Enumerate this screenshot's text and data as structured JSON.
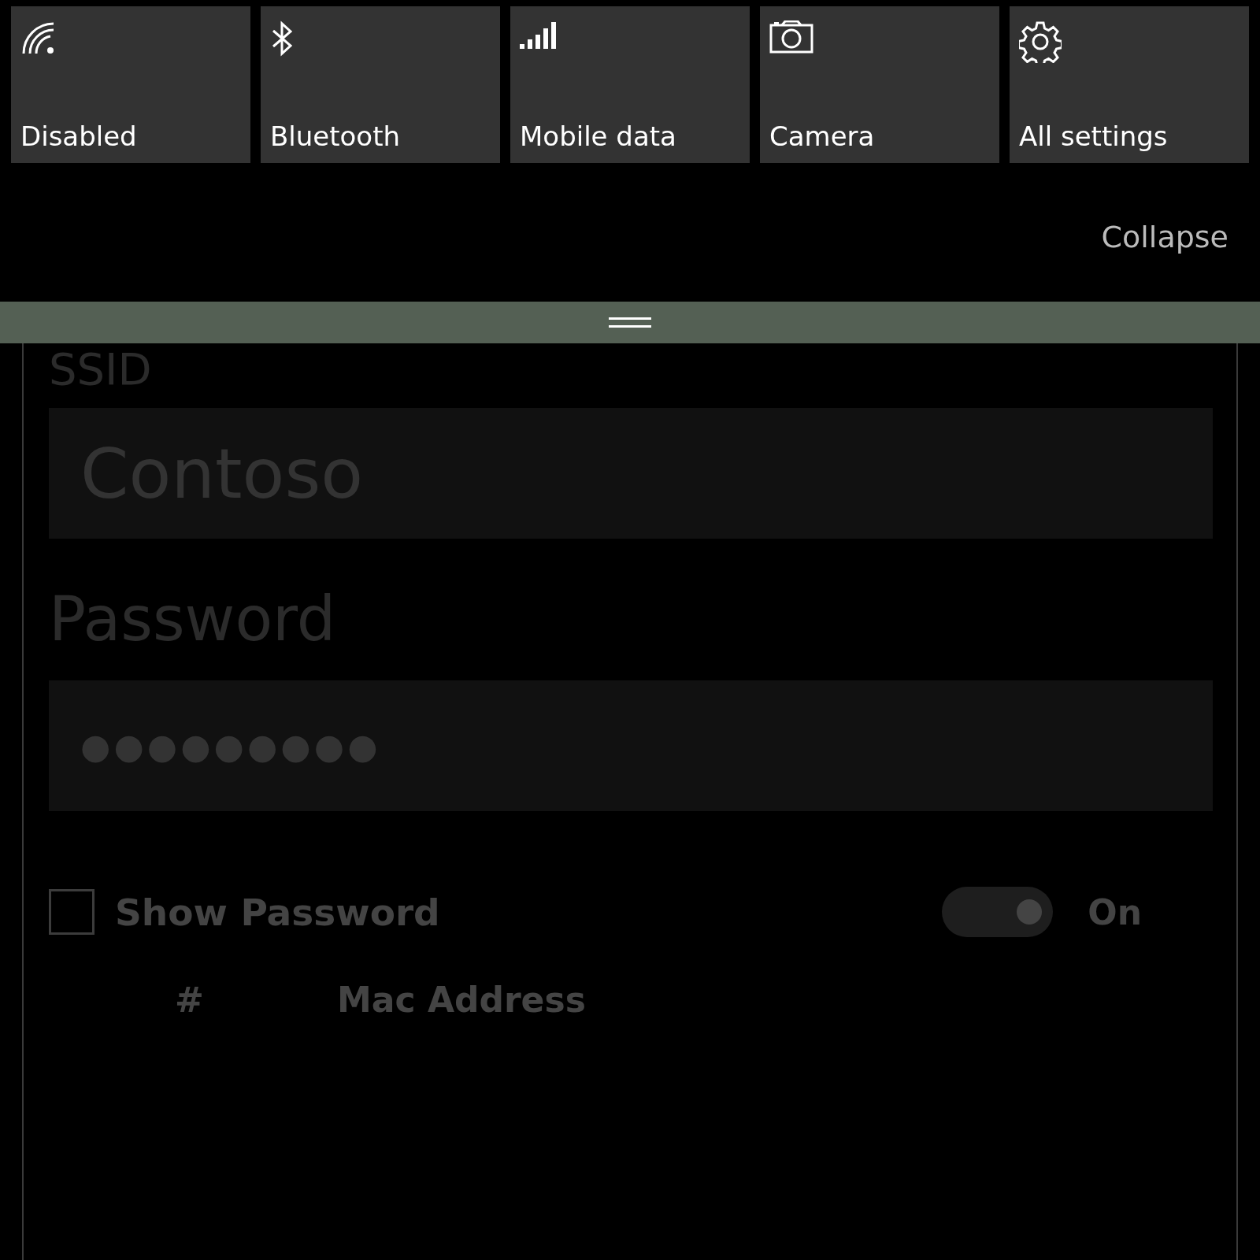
{
  "quick_actions": [
    {
      "kind": "wifi",
      "label": "Disabled"
    },
    {
      "kind": "bluetooth",
      "label": "Bluetooth"
    },
    {
      "kind": "signal",
      "label": "Mobile data"
    },
    {
      "kind": "camera",
      "label": "Camera"
    },
    {
      "kind": "settings",
      "label": "All settings"
    }
  ],
  "collapse_link": "Collapse",
  "form": {
    "ssid_label": "SSID",
    "ssid_value": "Contoso",
    "password_label": "Password",
    "password_value": "●●●●●●●●●",
    "show_password": {
      "label": "Show Password",
      "checked": false
    },
    "toggle": {
      "on": true,
      "label": "On"
    },
    "table": {
      "columns": [
        "#",
        "Mac Address"
      ]
    }
  }
}
